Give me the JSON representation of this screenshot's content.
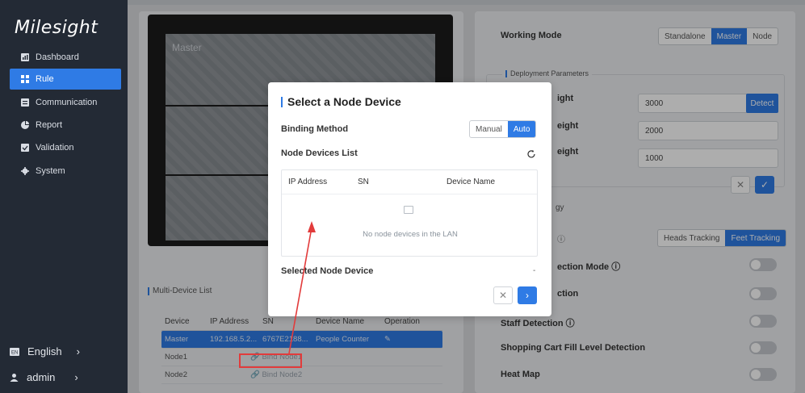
{
  "brand": {
    "name": "Milesight"
  },
  "sidebar": {
    "items": [
      {
        "label": "Dashboard",
        "icon": "dashboard-icon"
      },
      {
        "label": "Rule",
        "icon": "rule-icon",
        "active": true
      },
      {
        "label": "Communication",
        "icon": "communication-icon"
      },
      {
        "label": "Report",
        "icon": "report-icon"
      },
      {
        "label": "Validation",
        "icon": "validation-icon"
      },
      {
        "label": "System",
        "icon": "gear-icon"
      }
    ],
    "language": "English",
    "user": "admin"
  },
  "preview": {
    "label": "Master"
  },
  "multi_device": {
    "title": "Multi-Device List",
    "columns": [
      "Device",
      "IP Address",
      "SN",
      "Device Name",
      "Operation"
    ],
    "rows": [
      {
        "device": "Master",
        "ip": "192.168.5.2...",
        "sn": "6767E2188...",
        "name": "People Counter",
        "operation": ""
      },
      {
        "device": "Node1",
        "ip": "",
        "sn": "",
        "name": "",
        "operation": "Bind Node1"
      },
      {
        "device": "Node2",
        "ip": "",
        "sn": "",
        "name": "",
        "operation": "Bind Node2"
      }
    ]
  },
  "settings": {
    "working_mode_label": "Working Mode",
    "working_mode_options": [
      "Standalone",
      "Master",
      "Node"
    ],
    "working_mode_selected": "Master",
    "deployment_title": "Deployment Parameters",
    "params": [
      {
        "label": "ight",
        "value": "3000"
      },
      {
        "label": "eight",
        "value": "2000"
      },
      {
        "label": "eight",
        "value": "1000"
      }
    ],
    "detect_label": "Detect",
    "strategy_fragment": "gy",
    "tracking_fragment": "ⓘ",
    "tracking_options": [
      "Heads Tracking",
      "Feet Tracking"
    ],
    "tracking_selected": "Feet Tracking",
    "rows": [
      {
        "label": "ection Mode ⓘ"
      },
      {
        "label": "ction"
      },
      {
        "label": "Staff Detection ⓘ"
      },
      {
        "label": "Shopping Cart Fill Level Detection"
      },
      {
        "label": "Heat Map"
      }
    ]
  },
  "modal": {
    "title": "Select a Node Device",
    "binding_label": "Binding Method",
    "binding_options": [
      "Manual",
      "Auto"
    ],
    "binding_selected": "Auto",
    "list_label": "Node Devices List",
    "columns": [
      "IP Address",
      "SN",
      "Device Name"
    ],
    "empty_text": "No node devices in the LAN",
    "selected_label": "Selected Node Device",
    "selected_value": "-"
  },
  "colors": {
    "accent": "#2f7be5",
    "sidebar": "#232a35",
    "annotation": "#e23b3b"
  }
}
